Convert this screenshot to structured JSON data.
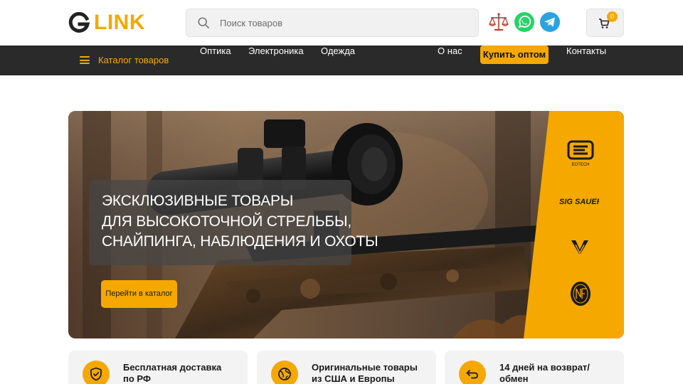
{
  "header": {
    "logo_text": "LINK",
    "search_placeholder": "Поиск товаров",
    "cart_count": "0",
    "icons": [
      "scales-icon",
      "whatsapp-icon",
      "telegram-icon",
      "cart-icon"
    ]
  },
  "nav": {
    "catalog_label": "Каталог товаров",
    "links": [
      "Оптика",
      "Электроника",
      "Одежда",
      "О нас",
      "Контакты"
    ],
    "wholesale_label": "Купить оптом"
  },
  "banner": {
    "headline": [
      "Эксклюзивные товары",
      "для высокоточной стрельбы,",
      "снайпинга, наблюдения и охоты"
    ],
    "cta_label": "Перейти в каталог",
    "brand_labels": [
      "EOTECH",
      "SIG SAUER"
    ]
  },
  "features": [
    {
      "line1": "Бесплатная доставка",
      "line2": "по РФ",
      "icon": "shield-check-icon"
    },
    {
      "line1": "Оригинальные товары",
      "line2": "из США и Европы",
      "icon": "globe-icon"
    },
    {
      "line1": "14 дней на возврат/",
      "line2": "обмен",
      "icon": "return-arrow-icon"
    }
  ],
  "colors": {
    "accent": "#f5a800",
    "navbar": "#2a2a2a",
    "card_bg": "#f3f3f3"
  }
}
